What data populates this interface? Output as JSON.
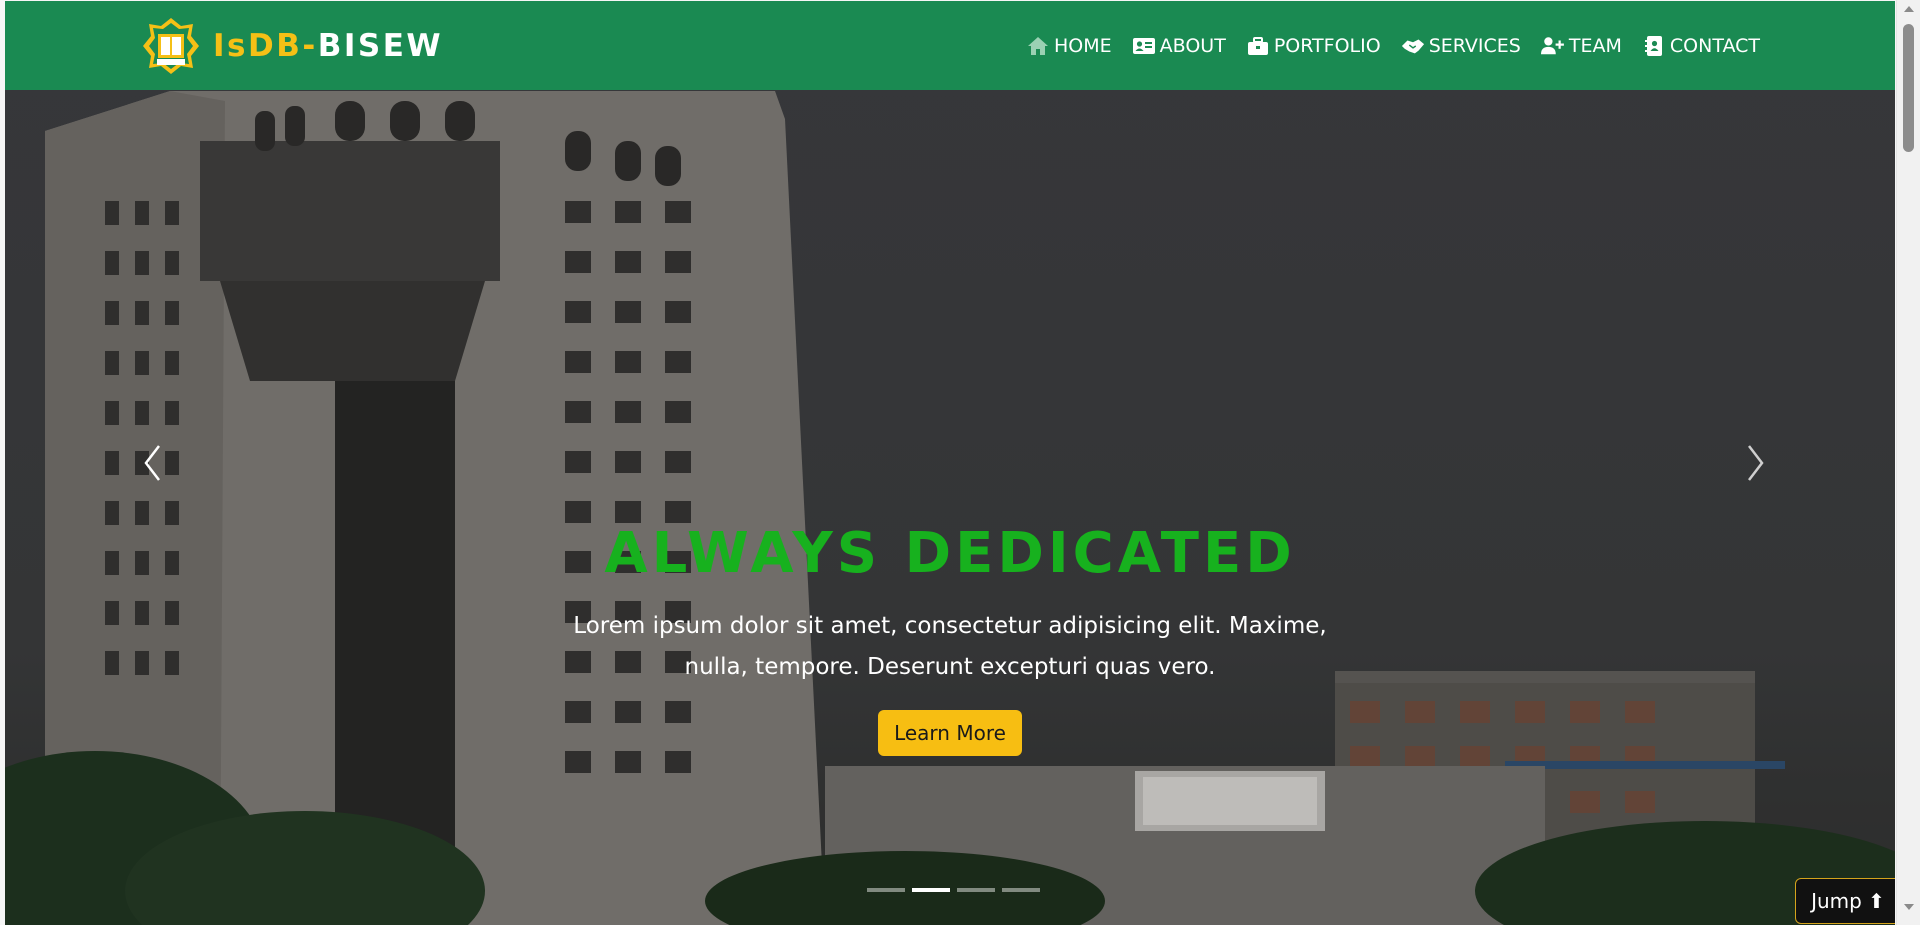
{
  "brand": {
    "part1": "IsDB",
    "dash": "-",
    "part2": "BISEW",
    "logo_icon": "isdb-bisew-logo"
  },
  "nav": {
    "items": [
      {
        "label": "HOME",
        "icon": "home-icon",
        "active": true
      },
      {
        "label": "ABOUT",
        "icon": "id-card-icon"
      },
      {
        "label": "PORTFOLIO",
        "icon": "briefcase-icon"
      },
      {
        "label": "SERVICES",
        "icon": "handshake-icon"
      },
      {
        "label": "TEAM",
        "icon": "user-plus-icon"
      },
      {
        "label": "CONTACT",
        "icon": "address-book-icon"
      }
    ]
  },
  "hero": {
    "title": "ALWAYS DEDICATED",
    "text": "Lorem ipsum dolor sit amet, consectetur adipisicing elit. Maxime, nulla, tempore. Deserunt excepturi quas vero.",
    "button": "Learn More",
    "slide_count": 4,
    "active_slide": 2
  },
  "jump": {
    "label": "Jump ⬆"
  },
  "colors": {
    "navbar": "#1a8a52",
    "brand_accent": "#f5c016",
    "title": "#17b11e",
    "button": "#f7be12"
  }
}
